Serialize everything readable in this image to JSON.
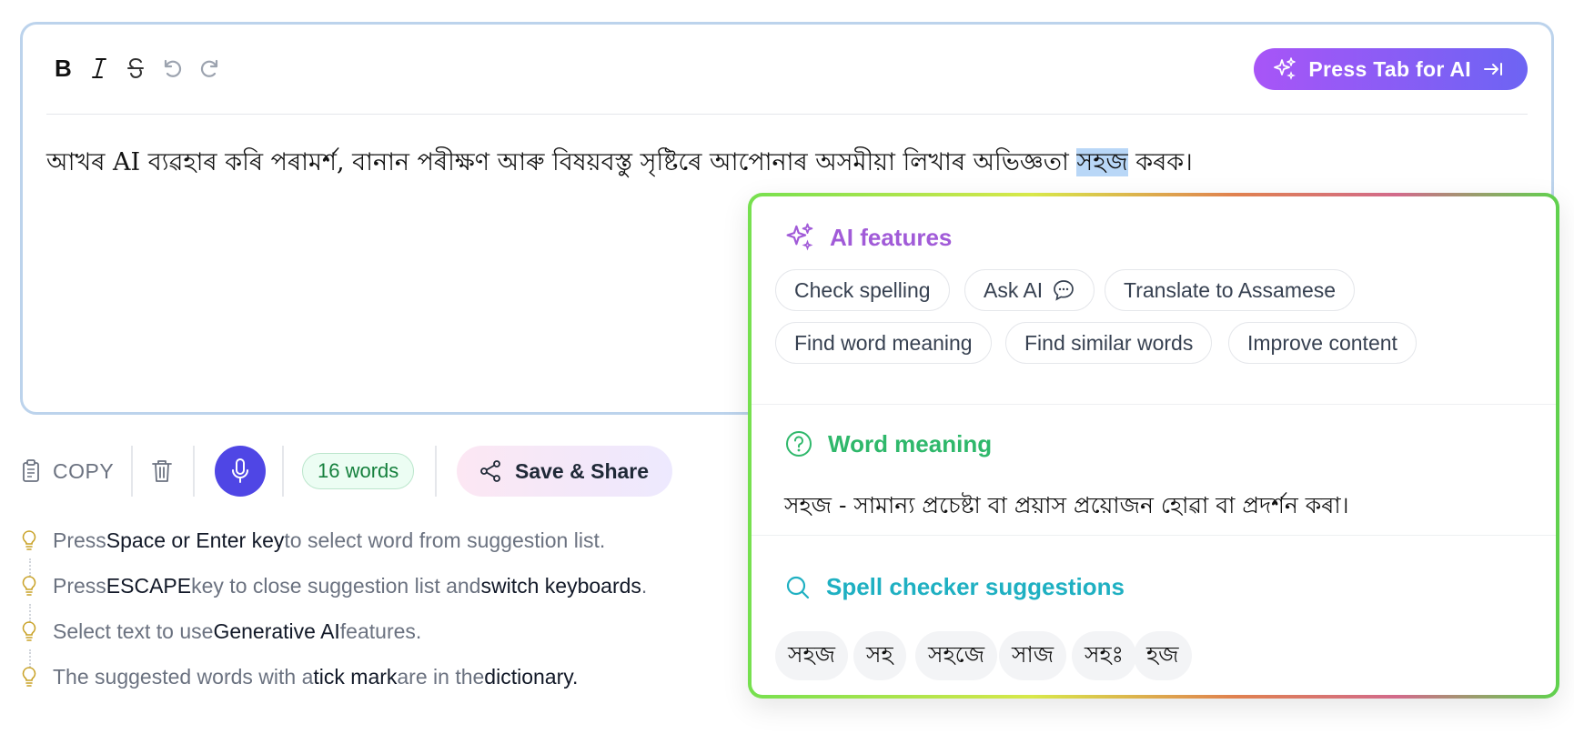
{
  "toolbar": {
    "bold_icon": "bold-icon",
    "italic_icon": "italic-icon",
    "strike_icon": "strikethrough-icon",
    "undo_icon": "undo-icon",
    "redo_icon": "redo-icon",
    "ai_button": {
      "label": "Press Tab for AI",
      "icon": "sparkles-icon",
      "trailing_icon": "tab-arrow-icon"
    }
  },
  "editor": {
    "text_before": "আখৰ AI ব্যৱহাৰ কৰি পৰামৰ্শ, বানান পৰীক্ষণ আৰু বিষয়বস্তু সৃষ্টিৰে আপোনাৰ অসমীয়া লিখাৰ অভিজ্ঞতা ",
    "selected_word": "সহজ",
    "text_after": " কৰক।"
  },
  "bottom_bar": {
    "copy_label": "COPY",
    "word_count": "16 words",
    "share_label": "Save & Share"
  },
  "tips": [
    {
      "pre": "Press ",
      "bold": "Space or Enter key",
      "post": " to select word from suggestion list.",
      "bold2": "",
      "post2": ""
    },
    {
      "pre": "Press ",
      "bold": "ESCAPE",
      "post": " key to close suggestion list and ",
      "bold2": "switch keyboards",
      "post2": "."
    },
    {
      "pre": "Select text to use ",
      "bold": "Generative AI",
      "post": " features.",
      "bold2": "",
      "post2": ""
    },
    {
      "pre": "The suggested words with a ",
      "bold": "tick mark",
      "post": " are in the ",
      "bold2": "dictionary.",
      "post2": ""
    }
  ],
  "popup": {
    "ai_features_title": "AI features",
    "ai_chips": [
      "Check spelling",
      "Ask AI",
      "Translate to Assamese",
      "Find word meaning",
      "Find similar words",
      "Improve content"
    ],
    "word_meaning_title": "Word meaning",
    "word_meaning_text": "সহজ - সামান্য প্ৰচেষ্টা বা প্ৰয়াস প্ৰয়োজন হোৱা বা প্ৰদৰ্শন কৰা।",
    "spell_title": "Spell checker suggestions",
    "suggestions": [
      "সহজ",
      "সহ",
      "সহজে",
      "সাজ",
      "সহঃ",
      "হজ"
    ]
  },
  "colors": {
    "ai_gradient_start": "#a855f7",
    "ai_gradient_end": "#6d64f3",
    "mic_bg": "#4f46e5",
    "ai_title": "#a15bd8",
    "word_meaning_title": "#2fb86b",
    "spell_title": "#1fb0c2",
    "selection": "#b9d7f7"
  }
}
